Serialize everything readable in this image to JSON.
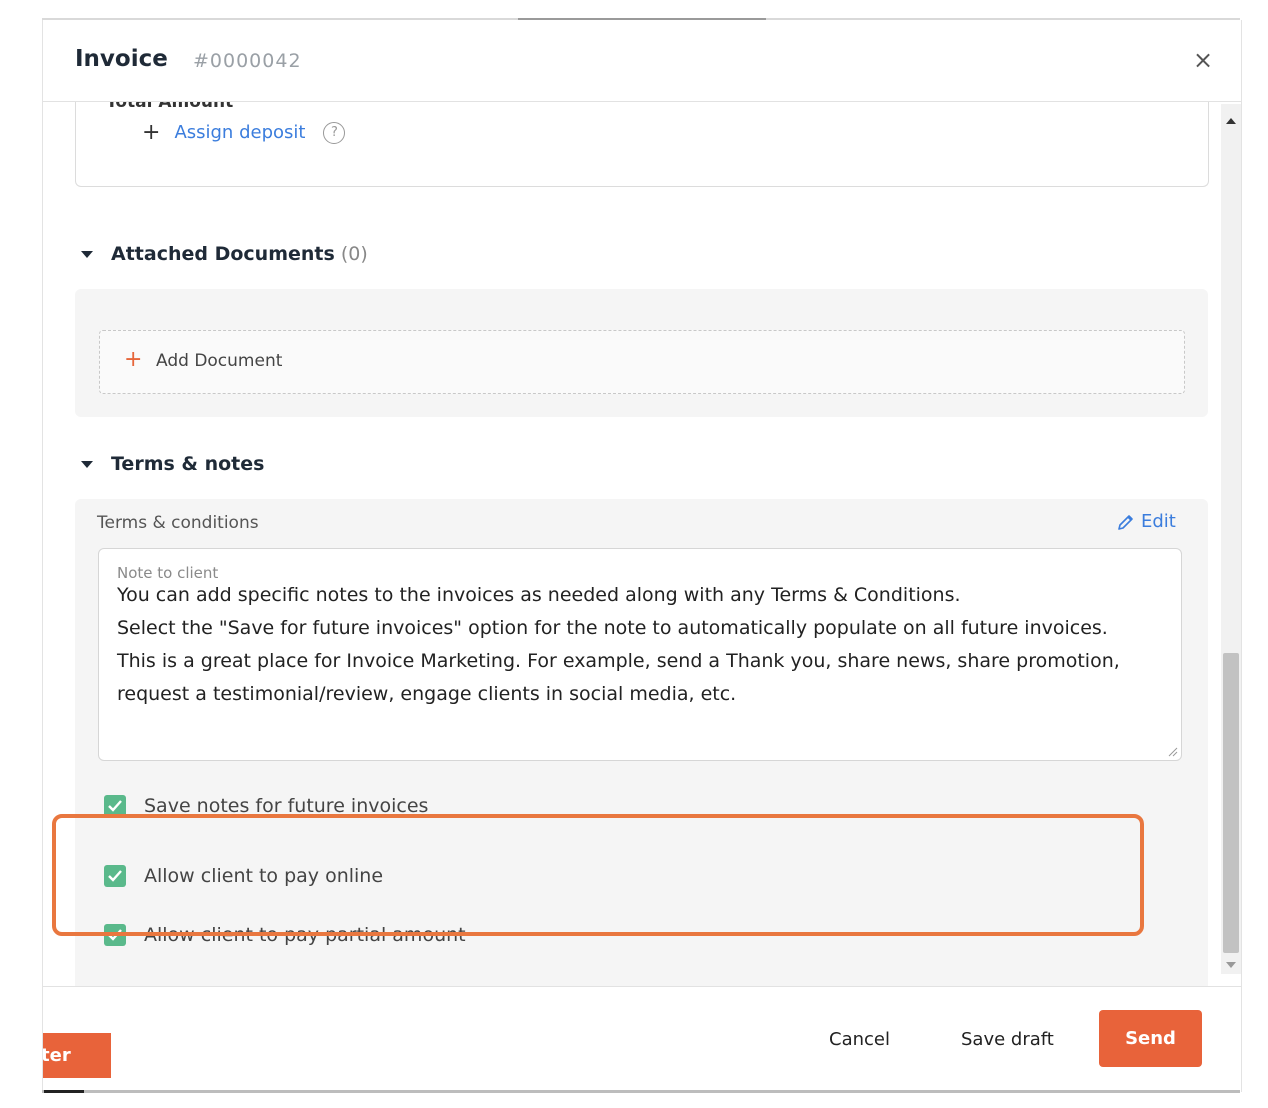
{
  "header": {
    "title": "Invoice",
    "invoice_number": "#0000042",
    "close_symbol": "×"
  },
  "summary": {
    "cut_label": "Total Amount",
    "assign_deposit": "Assign deposit",
    "help_symbol": "?"
  },
  "attached_documents": {
    "title": "Attached Documents",
    "count": "(0)",
    "add_label": "Add Document"
  },
  "terms_notes": {
    "title": "Terms & notes",
    "terms_label": "Terms & conditions",
    "edit_label": "Edit",
    "note_label": "Note to client",
    "note_lines": [
      "You can add specific notes to the invoices as needed along with any Terms & Conditions.",
      "Select the \"Save for future invoices\" option for the note to automatically populate on all future invoices.",
      "This is a great place for Invoice Marketing. For example, send a Thank you, share news, share promotion, request a testimonial/review, engage clients in social media, etc."
    ]
  },
  "options": {
    "save_notes": {
      "label": "Save notes for future invoices",
      "checked": true
    },
    "pay_online": {
      "label": "Allow client to pay online",
      "checked": true
    },
    "pay_partial": {
      "label": "Allow client to pay partial amount",
      "checked": true
    }
  },
  "footer": {
    "cancel": "Cancel",
    "save_draft": "Save draft",
    "send": "Send",
    "behind_button": "ter"
  },
  "colors": {
    "accent": "#e8633a",
    "link": "#3b7ddd",
    "checkbox": "#5ab98b",
    "highlight": "#e9773f"
  }
}
